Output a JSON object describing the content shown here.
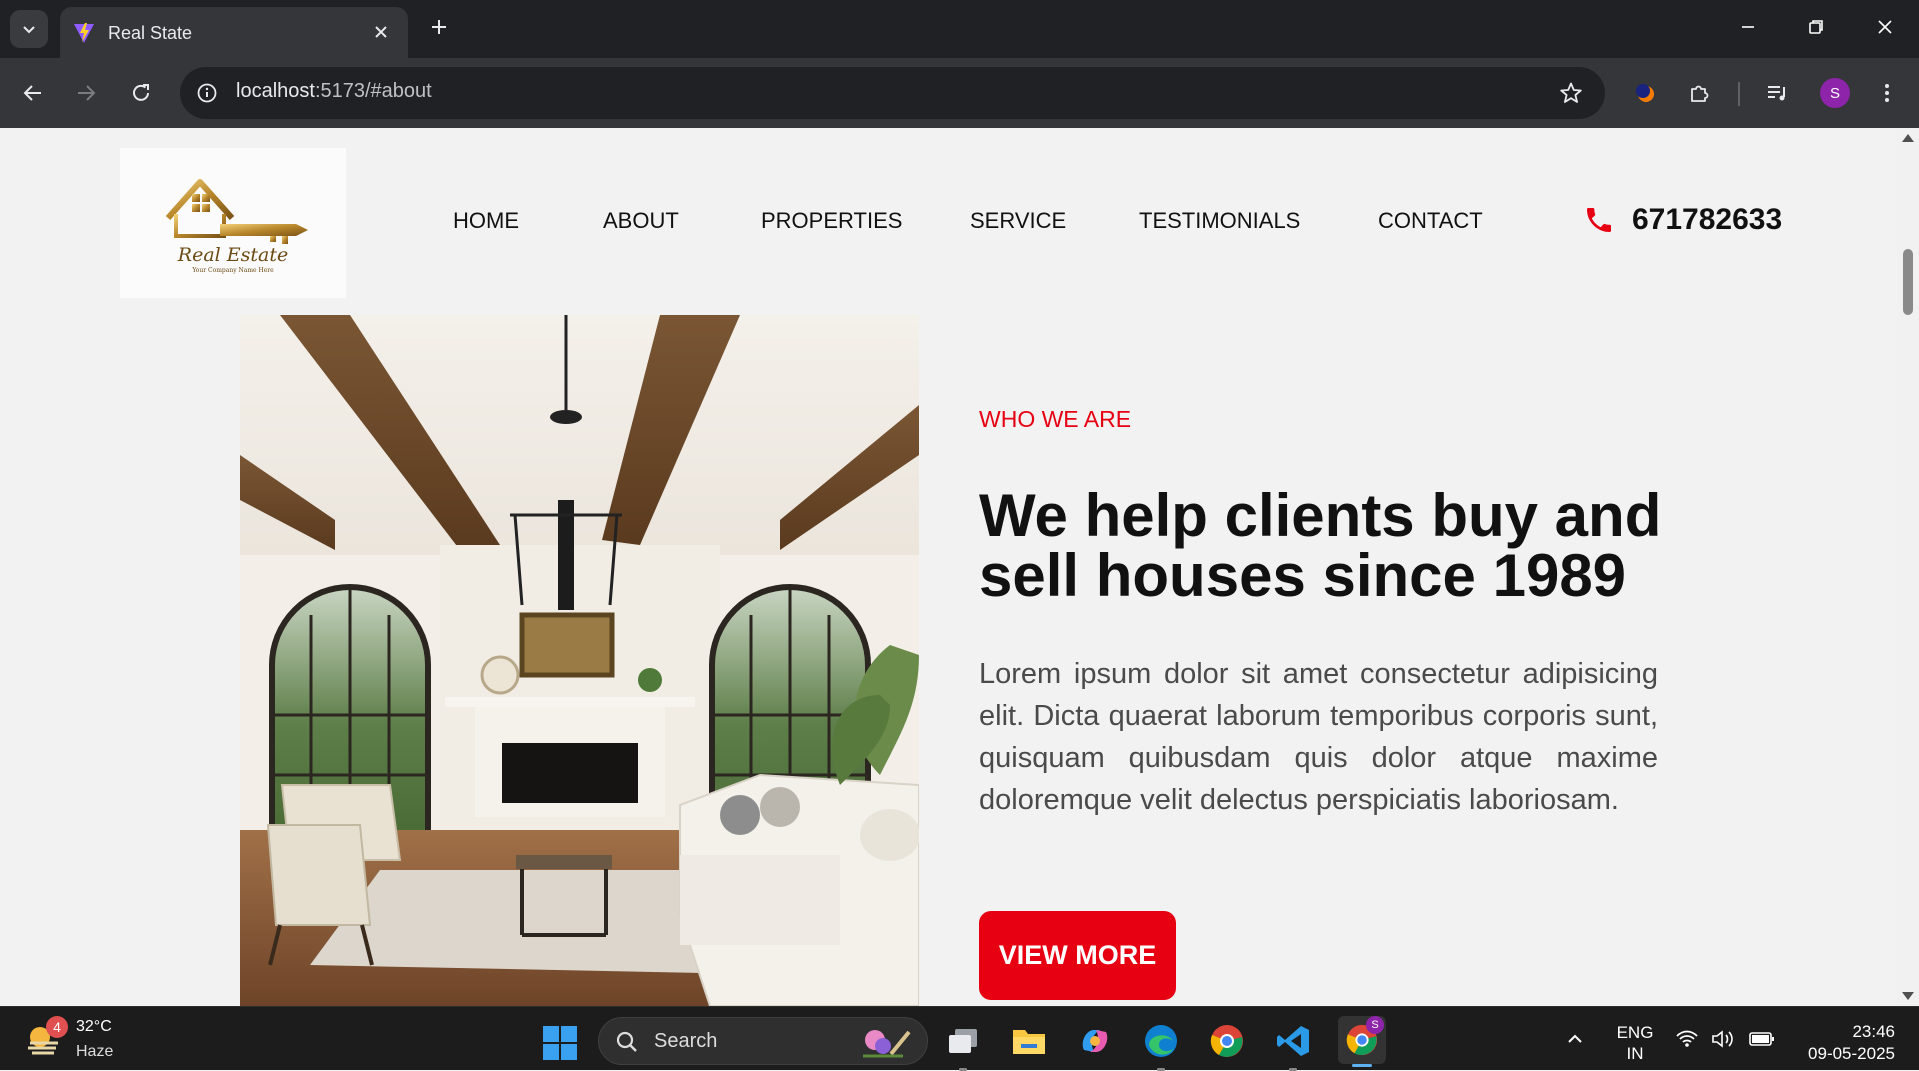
{
  "browser": {
    "tab_title": "Real State",
    "url_host": "localhost",
    "url_path": ":5173/#about",
    "profile_initial": "S"
  },
  "site": {
    "logo": {
      "brand": "Real Estate",
      "tagline": "Your Company Name Here"
    },
    "nav": [
      "HOME",
      "ABOUT",
      "PROPERTIES",
      "SERVICE",
      "TESTIMONIALS",
      "CONTACT"
    ],
    "phone": "671782633"
  },
  "about": {
    "kicker": "WHO WE ARE",
    "headline_line1": "We help clients buy and",
    "headline_line2": "sell houses since 1989",
    "body": "Lorem ipsum dolor sit amet consectetur adipisicing elit. Dicta quaerat laborum temporibus corporis sunt, quisquam quibusdam quis dolor atque maxime doloremque velit delectus perspiciatis laboriosam.",
    "cta": "VIEW MORE"
  },
  "taskbar": {
    "weather_badge": "4",
    "temperature": "32°C",
    "condition": "Haze",
    "search_label": "Search",
    "chrome_badge": "S",
    "lang_line1": "ENG",
    "lang_line2": "IN",
    "time": "23:46",
    "date": "09-05-2025"
  },
  "colors": {
    "accent": "#e60012",
    "page_bg": "#f2f2f2",
    "browser_dark": "#202124",
    "browser_toolbar": "#35363a"
  }
}
